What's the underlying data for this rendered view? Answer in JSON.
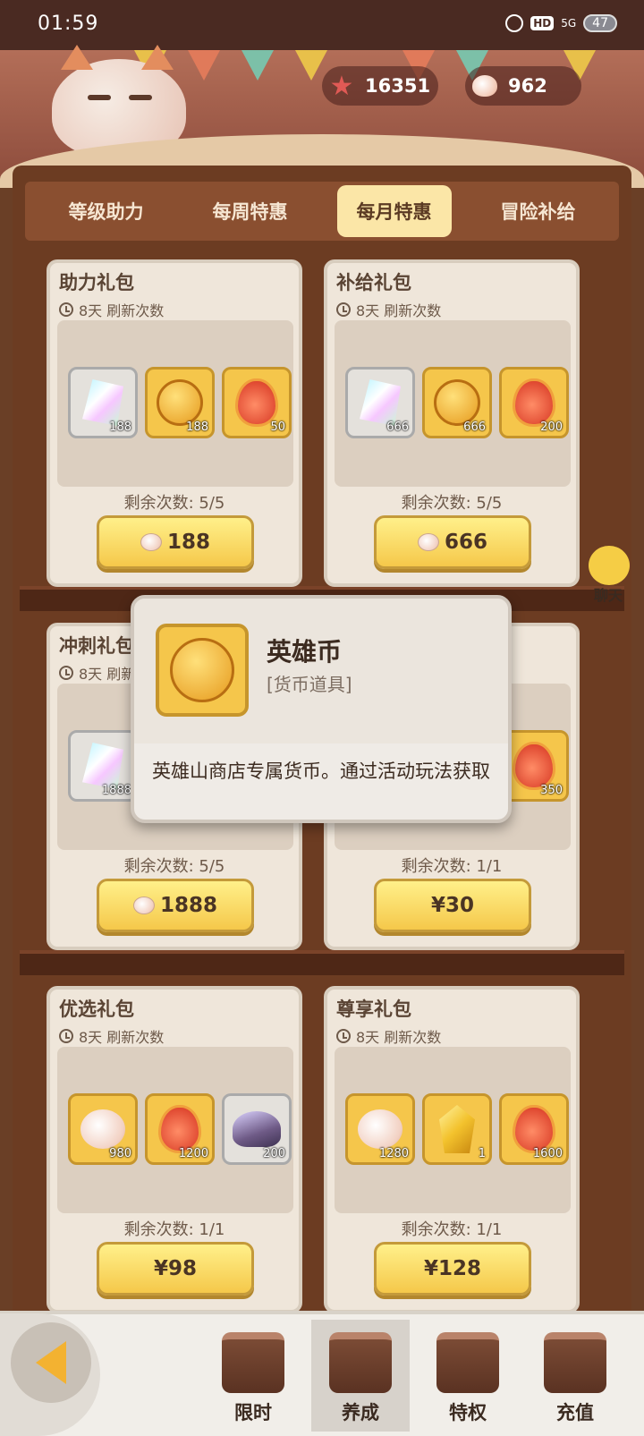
{
  "status_bar": {
    "time": "01:59",
    "network": "5G",
    "hd": "HD",
    "battery": "47"
  },
  "currencies": [
    {
      "icon": "starfish-icon",
      "value": "16351"
    },
    {
      "icon": "pearl-icon",
      "value": "962"
    }
  ],
  "tabs": [
    {
      "label": "等级助力",
      "active": false
    },
    {
      "label": "每周特惠",
      "active": false
    },
    {
      "label": "每月特惠",
      "active": true
    },
    {
      "label": "冒险补给",
      "active": false
    }
  ],
  "cards": [
    {
      "title": "助力礼包",
      "refresh": "8天 刷新次数",
      "items": [
        {
          "icon": "crystal-icon",
          "qty": "188"
        },
        {
          "icon": "hero-coin-icon",
          "qty": "188"
        },
        {
          "icon": "fire-token-icon",
          "qty": "50"
        }
      ],
      "remain": "剩余次数: 5/5",
      "price": "188",
      "price_icon": "pearl-icon"
    },
    {
      "title": "补给礼包",
      "refresh": "8天 刷新次数",
      "items": [
        {
          "icon": "crystal-icon",
          "qty": "666"
        },
        {
          "icon": "hero-coin-icon",
          "qty": "666"
        },
        {
          "icon": "fire-token-icon",
          "qty": "200"
        }
      ],
      "remain": "剩余次数: 5/5",
      "price": "666",
      "price_icon": "pearl-icon"
    },
    {
      "title": "冲刺礼包",
      "refresh": "8天 刷新次数",
      "items": [
        {
          "icon": "crystal-icon",
          "qty": "1888"
        }
      ],
      "remain": "剩余次数: 5/5",
      "price": "1888",
      "price_icon": "pearl-icon"
    },
    {
      "title": "",
      "refresh": "",
      "items": [
        {
          "icon": "fire-token-icon",
          "qty": "350"
        }
      ],
      "remain": "剩余次数: 1/1",
      "price": "¥30",
      "price_icon": ""
    },
    {
      "title": "优选礼包",
      "refresh": "8天 刷新次数",
      "items": [
        {
          "icon": "pearl-icon",
          "qty": "980"
        },
        {
          "icon": "fire-token-icon",
          "qty": "1200"
        },
        {
          "icon": "shell-icon",
          "qty": "200"
        }
      ],
      "remain": "剩余次数: 1/1",
      "price": "¥98",
      "price_icon": ""
    },
    {
      "title": "尊享礼包",
      "refresh": "8天 刷新次数",
      "items": [
        {
          "icon": "pearl-icon",
          "qty": "1280"
        },
        {
          "icon": "topaz-icon",
          "qty": "1"
        },
        {
          "icon": "fire-token-icon",
          "qty": "1600"
        }
      ],
      "remain": "剩余次数: 1/1",
      "price": "¥128",
      "price_icon": ""
    }
  ],
  "tooltip": {
    "name": "英雄币",
    "category": "[货币道具]",
    "description": "英雄山商店专属货币。通过活动玩法获取",
    "icon": "hero-coin-icon"
  },
  "chat": {
    "label": "聊天"
  },
  "bottom_nav": [
    {
      "label": "限时",
      "active": false
    },
    {
      "label": "养成",
      "active": true
    },
    {
      "label": "特权",
      "active": false
    },
    {
      "label": "充值",
      "active": false
    }
  ],
  "colors": {
    "accent": "#f5c64b",
    "frame": "#6c3c22",
    "card": "#efe6da"
  }
}
